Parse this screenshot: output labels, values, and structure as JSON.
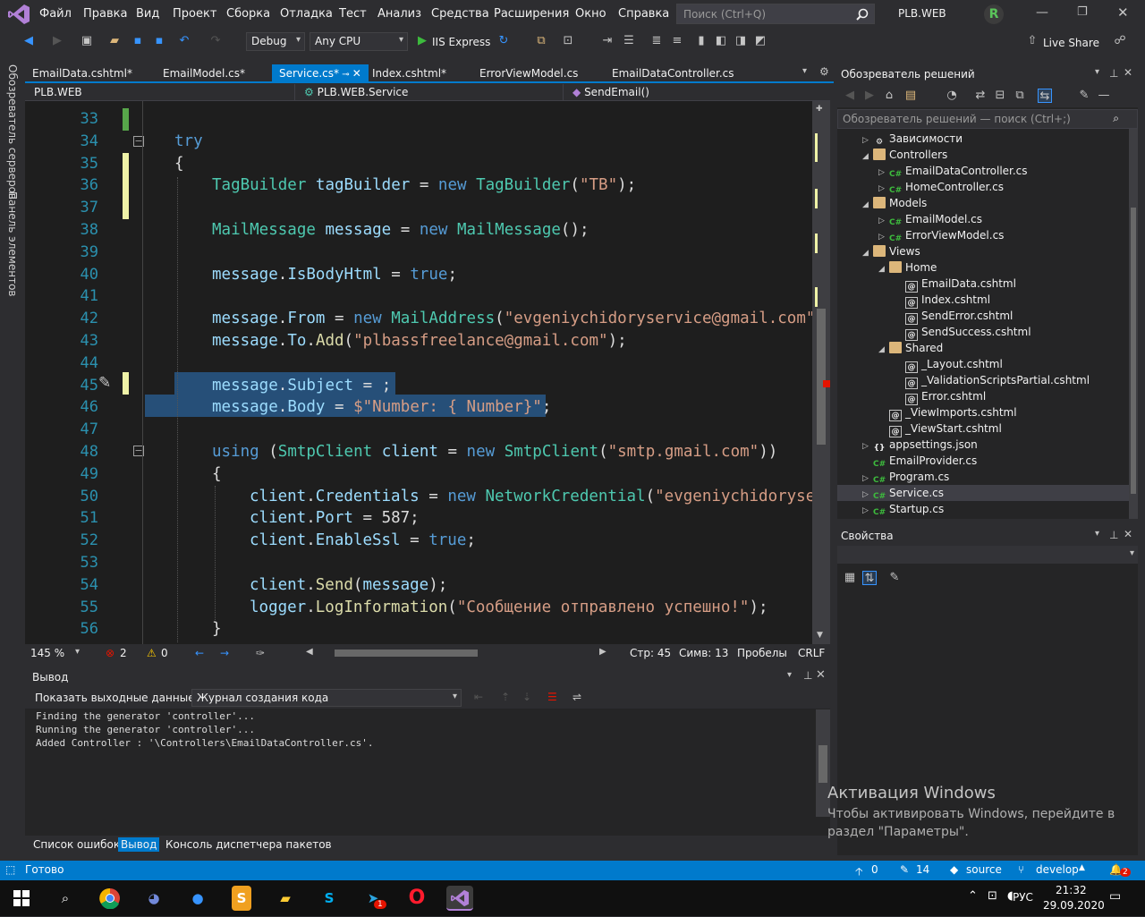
{
  "menubar": {
    "items": [
      "Файл",
      "Правка",
      "Вид",
      "Проект",
      "Сборка",
      "Отладка",
      "Тест",
      "Анализ",
      "Средства",
      "Расширения",
      "Окно",
      "Справка"
    ],
    "search_placeholder": "Поиск (Ctrl+Q)",
    "solution_name": "PLB.WEB",
    "user_initial": "R"
  },
  "toolbar": {
    "config": "Debug",
    "platform": "Any CPU",
    "run_target": "IIS Express",
    "live_share": "Live Share"
  },
  "left_rail": {
    "items": [
      "Обозреватель серверов",
      "Панель элементов"
    ]
  },
  "doc_tabs": [
    {
      "label": "EmailData.cshtml*",
      "active": false
    },
    {
      "label": "EmailModel.cs*",
      "active": false
    },
    {
      "label": "Service.cs*",
      "active": true
    },
    {
      "label": "Index.cshtml*",
      "active": false
    },
    {
      "label": "ErrorViewModel.cs",
      "active": false
    },
    {
      "label": "EmailDataController.cs",
      "active": false
    }
  ],
  "navbar": {
    "project": "PLB.WEB",
    "class": "PLB.WEB.Service",
    "member": "SendEmail()"
  },
  "editor": {
    "lines": [
      {
        "n": "33",
        "code": ""
      },
      {
        "n": "34",
        "code": "try"
      },
      {
        "n": "35",
        "code": "{"
      },
      {
        "n": "36",
        "code": "TagBuilder tagBuilder = new TagBuilder(\"TB\");"
      },
      {
        "n": "37",
        "code": ""
      },
      {
        "n": "38",
        "code": "MailMessage message = new MailMessage();"
      },
      {
        "n": "39",
        "code": ""
      },
      {
        "n": "40",
        "code": "message.IsBodyHtml = true;"
      },
      {
        "n": "41",
        "code": ""
      },
      {
        "n": "42",
        "code": "message.From = new MailAddress(\"evgeniychidoryservice@gmail.com\","
      },
      {
        "n": "43",
        "code": "message.To.Add(\"plbassfreelance@gmail.com\");"
      },
      {
        "n": "44",
        "code": ""
      },
      {
        "n": "45",
        "code": "message.Subject = ;"
      },
      {
        "n": "46",
        "code": "message.Body = $\"Number: { Number}\";"
      },
      {
        "n": "47",
        "code": ""
      },
      {
        "n": "48",
        "code": "using (SmtpClient client = new SmtpClient(\"smtp.gmail.com\"))"
      },
      {
        "n": "49",
        "code": "{"
      },
      {
        "n": "50",
        "code": "client.Credentials = new NetworkCredential(\"evgeniychidoryser"
      },
      {
        "n": "51",
        "code": "client.Port = 587;"
      },
      {
        "n": "52",
        "code": "client.EnableSsl = true;"
      },
      {
        "n": "53",
        "code": ""
      },
      {
        "n": "54",
        "code": "client.Send(message);"
      },
      {
        "n": "55",
        "code": "logger.LogInformation(\"Сообщение отправлено успешно!\");"
      },
      {
        "n": "56",
        "code": "}"
      }
    ]
  },
  "editor_status": {
    "zoom": "145 %",
    "errors": "2",
    "warnings": "0",
    "line": "Стр: 45",
    "col": "Симв: 13",
    "whitespace": "Пробелы",
    "eol": "CRLF"
  },
  "output": {
    "title": "Вывод",
    "show_label": "Показать выходные данные из:",
    "source": "Журнал создания кода",
    "text": "Finding the generator 'controller'...\nRunning the generator 'controller'...\nAdded Controller : '\\Controllers\\EmailDataController.cs'."
  },
  "bottom_tabs": [
    {
      "label": "Список ошибок",
      "active": false
    },
    {
      "label": "Вывод",
      "active": true
    },
    {
      "label": "Консоль диспетчера пакетов",
      "active": false
    }
  ],
  "solution_explorer": {
    "title": "Обозреватель решений",
    "search_placeholder": "Обозреватель решений — поиск (Ctrl+;)",
    "items": [
      {
        "label": "Зависимости",
        "depth": 0,
        "expander": "▷",
        "icon": "dependencies",
        "selected": false
      },
      {
        "label": "Controllers",
        "depth": 0,
        "expander": "◢",
        "icon": "folder",
        "selected": false
      },
      {
        "label": "EmailDataController.cs",
        "depth": 1,
        "expander": "▷",
        "icon": "csharp",
        "selected": false
      },
      {
        "label": "HomeController.cs",
        "depth": 1,
        "expander": "▷",
        "icon": "csharp",
        "selected": false
      },
      {
        "label": "Models",
        "depth": 0,
        "expander": "◢",
        "icon": "folder",
        "selected": false
      },
      {
        "label": "EmailModel.cs",
        "depth": 1,
        "expander": "▷",
        "icon": "csharp",
        "selected": false
      },
      {
        "label": "ErrorViewModel.cs",
        "depth": 1,
        "expander": "▷",
        "icon": "csharp",
        "selected": false
      },
      {
        "label": "Views",
        "depth": 0,
        "expander": "◢",
        "icon": "folder",
        "selected": false
      },
      {
        "label": "Home",
        "depth": 1,
        "expander": "◢",
        "icon": "folder",
        "selected": false
      },
      {
        "label": "EmailData.cshtml",
        "depth": 2,
        "expander": "",
        "icon": "cshtml",
        "selected": false
      },
      {
        "label": "Index.cshtml",
        "depth": 2,
        "expander": "",
        "icon": "cshtml",
        "selected": false
      },
      {
        "label": "SendError.cshtml",
        "depth": 2,
        "expander": "",
        "icon": "cshtml",
        "selected": false
      },
      {
        "label": "SendSuccess.cshtml",
        "depth": 2,
        "expander": "",
        "icon": "cshtml",
        "selected": false
      },
      {
        "label": "Shared",
        "depth": 1,
        "expander": "◢",
        "icon": "folder",
        "selected": false
      },
      {
        "label": "_Layout.cshtml",
        "depth": 2,
        "expander": "",
        "icon": "cshtml",
        "selected": false
      },
      {
        "label": "_ValidationScriptsPartial.cshtml",
        "depth": 2,
        "expander": "",
        "icon": "cshtml",
        "selected": false
      },
      {
        "label": "Error.cshtml",
        "depth": 2,
        "expander": "",
        "icon": "cshtml",
        "selected": false
      },
      {
        "label": "_ViewImports.cshtml",
        "depth": 1,
        "expander": "",
        "icon": "cshtml",
        "selected": false
      },
      {
        "label": "_ViewStart.cshtml",
        "depth": 1,
        "expander": "",
        "icon": "cshtml",
        "selected": false
      },
      {
        "label": "appsettings.json",
        "depth": 0,
        "expander": "▷",
        "icon": "json",
        "selected": false
      },
      {
        "label": "EmailProvider.cs",
        "depth": 0,
        "expander": "",
        "icon": "csharp",
        "selected": false
      },
      {
        "label": "Program.cs",
        "depth": 0,
        "expander": "▷",
        "icon": "csharp",
        "selected": false
      },
      {
        "label": "Service.cs",
        "depth": 0,
        "expander": "▷",
        "icon": "csharp",
        "selected": true
      },
      {
        "label": "Startup.cs",
        "depth": 0,
        "expander": "▷",
        "icon": "csharp",
        "selected": false
      }
    ]
  },
  "properties": {
    "title": "Свойства"
  },
  "activation": {
    "title": "Активация Windows",
    "line1": "Чтобы активировать Windows, перейдите в",
    "line2": "раздел \"Параметры\"."
  },
  "statusbar": {
    "ready": "Готово",
    "up_count": "0",
    "pencil_count": "14",
    "repo": "source",
    "branch": "develop",
    "notifications": "2"
  },
  "taskbar": {
    "lang": "РУС",
    "time": "21:32",
    "date": "29.09.2020",
    "telegram_badge": "1"
  },
  "colors": {
    "accent": "#007acc",
    "selection": "#264f78",
    "keyword": "#569cd6",
    "type": "#4ec9b0",
    "string": "#d69d85"
  }
}
